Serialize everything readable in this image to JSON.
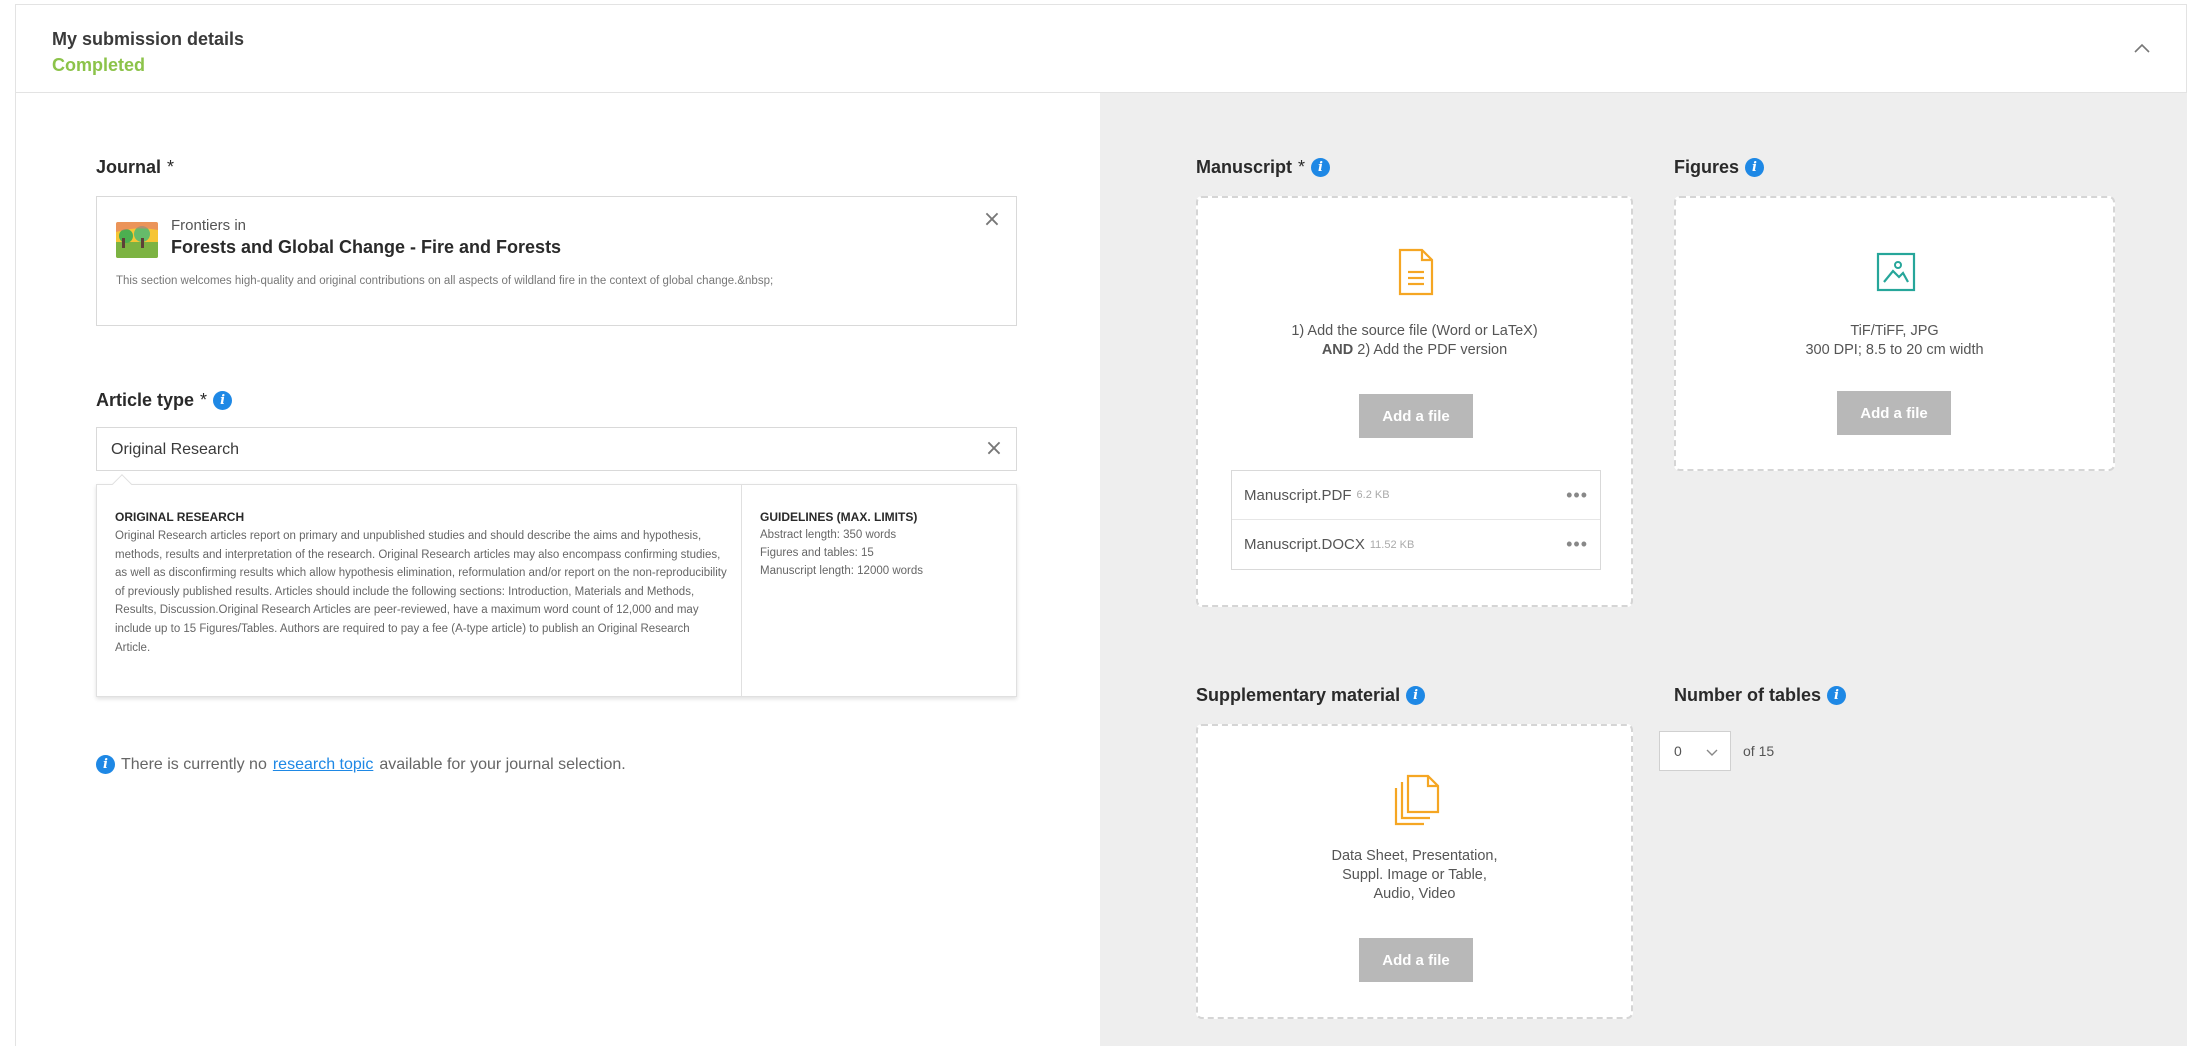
{
  "header": {
    "title": "My submission details",
    "status": "Completed"
  },
  "journal": {
    "label": "Journal",
    "required_mark": "*",
    "prefix": "Frontiers in",
    "name": "Forests and Global Change - Fire and Forests",
    "description": "This section welcomes high-quality and original contributions on all aspects of wildland fire in the context of global change.&nbsp;"
  },
  "article_type": {
    "label": "Article type",
    "required_mark": "*",
    "selected": "Original Research",
    "card_title": "ORIGINAL RESEARCH",
    "card_description": "Original Research articles report on primary and unpublished studies and should describe the aims and hypothesis, methods, results and interpretation of the research. Original Research articles may also encompass confirming studies, as well as disconfirming results which allow hypothesis elimination, reformulation and/or report on the non-reproducibility of previously published results. Articles should include the following sections: Introduction, Materials and Methods, Results, Discussion.Original Research Articles are peer-reviewed, have a maximum word count of 12,000 and may include up to 15 Figures/Tables. Authors are required to pay a fee (A-type article) to publish an Original Research Article.",
    "guidelines_title": "GUIDELINES (MAX. LIMITS)",
    "guidelines": [
      "Abstract length: 350 words",
      "Figures and tables: 15",
      "Manuscript length: 12000 words"
    ]
  },
  "research_topic_note": {
    "before": "There is currently no",
    "link": "research topic",
    "after": "available for your journal selection."
  },
  "manuscript": {
    "label": "Manuscript",
    "required_mark": "*",
    "instruction_line1": "1) Add the source file (Word or LaTeX)",
    "instruction_and": "AND",
    "instruction_line2": "2) Add the PDF version",
    "button": "Add a file",
    "files": [
      {
        "name": "Manuscript.PDF",
        "size": "6.2 KB"
      },
      {
        "name": "Manuscript.DOCX",
        "size": "11.52 KB"
      }
    ],
    "file_menu": "•••"
  },
  "figures": {
    "label": "Figures",
    "line1": "TiF/TiFF, JPG",
    "line2": "300 DPI; 8.5 to 20 cm width",
    "button": "Add a file"
  },
  "supplementary": {
    "label": "Supplementary material",
    "line1": "Data Sheet, Presentation,",
    "line2": "Suppl. Image or Table,",
    "line3": "Audio, Video",
    "button": "Add a file"
  },
  "tables": {
    "label": "Number of tables",
    "value": "0",
    "of_text": "of 15"
  },
  "colors": {
    "accent_blue": "#1e88e5",
    "status_green": "#8cc34a",
    "icon_orange": "#f5a623",
    "icon_teal": "#26a69a",
    "button_gray": "#b8b8b8",
    "right_panel_bg": "#eeeeee"
  },
  "icons": {
    "collapse": "chevron-up-icon",
    "clear": "close-icon",
    "info": "info-icon",
    "manuscript": "document-icon",
    "figures": "image-icon",
    "supplementary": "files-stack-icon",
    "dropdown": "chevron-down-icon"
  }
}
